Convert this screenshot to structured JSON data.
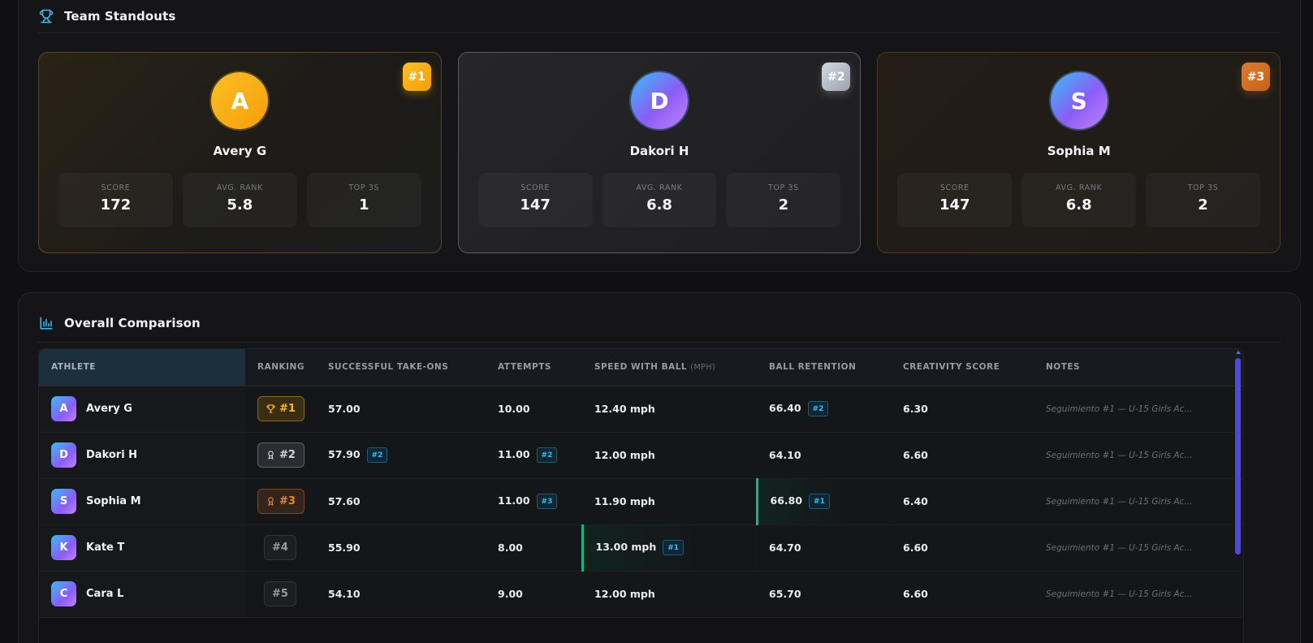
{
  "standouts": {
    "title": "Team Standouts",
    "icon": "trophy-icon",
    "cards": [
      {
        "rank": "#1",
        "initial": "A",
        "name": "Avery G",
        "stats": [
          {
            "label": "SCORE",
            "value": "172"
          },
          {
            "label": "AVG. RANK",
            "value": "5.8"
          },
          {
            "label": "TOP 3S",
            "value": "1"
          }
        ]
      },
      {
        "rank": "#2",
        "initial": "D",
        "name": "Dakori H",
        "stats": [
          {
            "label": "SCORE",
            "value": "147"
          },
          {
            "label": "AVG. RANK",
            "value": "6.8"
          },
          {
            "label": "TOP 3S",
            "value": "2"
          }
        ]
      },
      {
        "rank": "#3",
        "initial": "S",
        "name": "Sophia M",
        "stats": [
          {
            "label": "SCORE",
            "value": "147"
          },
          {
            "label": "AVG. RANK",
            "value": "6.8"
          },
          {
            "label": "TOP 3S",
            "value": "2"
          }
        ]
      }
    ]
  },
  "comparison": {
    "title": "Overall Comparison",
    "icon": "bar-chart-icon",
    "headers": {
      "athlete": "ATHLETE",
      "ranking": "RANKING",
      "takeons": "SUCCESSFUL TAKE-ONS",
      "attempts": "ATTEMPTS",
      "speed": "SPEED WITH BALL",
      "speed_unit": "(MPH)",
      "retention": "BALL RETENTION",
      "creativity": "CREATIVITY SCORE",
      "notes": "NOTES"
    },
    "rows": [
      {
        "initial": "A",
        "name": "Avery G",
        "rank": "#1",
        "takeons": "57.00",
        "takeons_tag": "",
        "attempts": "10.00",
        "attempts_tag": "",
        "speed": "12.40 mph",
        "speed_tag": "",
        "retention": "66.40",
        "retention_tag": "#2",
        "creativity": "6.30",
        "notes": "Seguimiento #1 — U-15 Girls Ac..."
      },
      {
        "initial": "D",
        "name": "Dakori H",
        "rank": "#2",
        "takeons": "57.90",
        "takeons_tag": "#2",
        "attempts": "11.00",
        "attempts_tag": "#2",
        "speed": "12.00 mph",
        "speed_tag": "",
        "retention": "64.10",
        "retention_tag": "",
        "creativity": "6.60",
        "notes": "Seguimiento #1 — U-15 Girls Ac..."
      },
      {
        "initial": "S",
        "name": "Sophia M",
        "rank": "#3",
        "takeons": "57.60",
        "takeons_tag": "",
        "attempts": "11.00",
        "attempts_tag": "#3",
        "speed": "11.90 mph",
        "speed_tag": "",
        "retention": "66.80",
        "retention_tag": "#1",
        "creativity": "6.40",
        "notes": "Seguimiento #1 — U-15 Girls Ac..."
      },
      {
        "initial": "K",
        "name": "Kate T",
        "rank": "#4",
        "takeons": "55.90",
        "takeons_tag": "",
        "attempts": "8.00",
        "attempts_tag": "",
        "speed": "13.00 mph",
        "speed_tag": "#1",
        "retention": "64.70",
        "retention_tag": "",
        "creativity": "6.60",
        "notes": "Seguimiento #1 — U-15 Girls Ac..."
      },
      {
        "initial": "C",
        "name": "Cara L",
        "rank": "#5",
        "takeons": "54.10",
        "takeons_tag": "",
        "attempts": "9.00",
        "attempts_tag": "",
        "speed": "12.00 mph",
        "speed_tag": "",
        "retention": "65.70",
        "retention_tag": "",
        "creativity": "6.60",
        "notes": "Seguimiento #1 — U-15 Girls Ac..."
      }
    ]
  },
  "colors": {
    "accent": "#38bdf8",
    "gold": "#f59e0b",
    "silver": "#9ca3af",
    "bronze": "#c2621a",
    "best": "#10b981",
    "scrollbar": "#4f46e5"
  }
}
